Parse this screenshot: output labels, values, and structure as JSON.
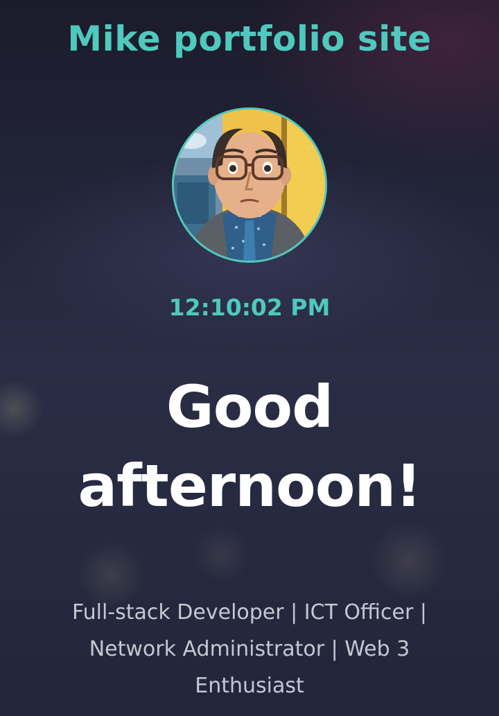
{
  "site": {
    "title": "Mike portfolio site"
  },
  "profile": {
    "avatar_icon": "profile-avatar-illustration"
  },
  "clock": {
    "time": "12:10:02 PM"
  },
  "hero": {
    "greeting": "Good afternoon!",
    "roles": "Full-stack Developer | ICT Officer | Network Administrator | Web 3 Enthusiast"
  },
  "colors": {
    "accent": "#4fc9bd",
    "text_primary": "#ffffff",
    "text_secondary": "#c5c7d2"
  }
}
